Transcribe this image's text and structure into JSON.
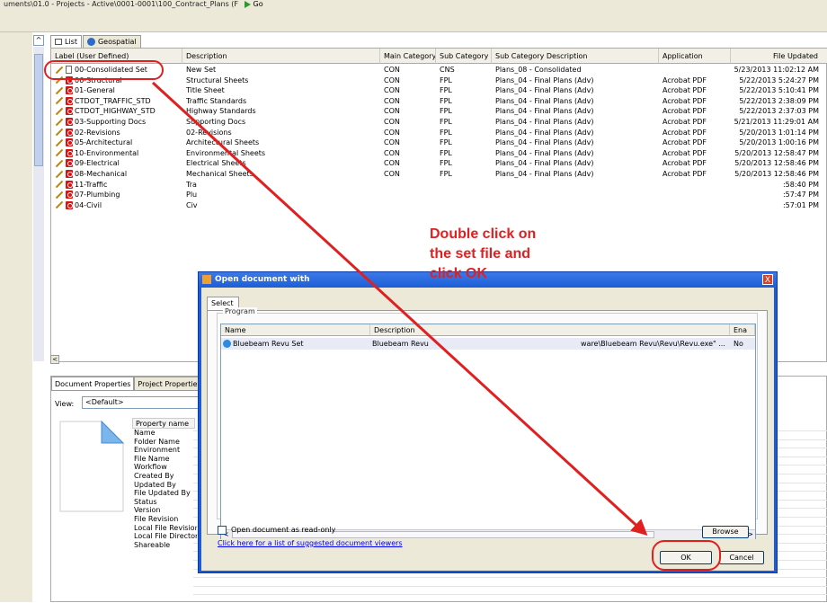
{
  "toolbar": {
    "path": "uments\\01.0 - Projects - Active\\0001-0001\\100_Contract_Plans (F",
    "go_label": "Go"
  },
  "tabs": [
    {
      "label": "List",
      "icon": "list-icon"
    },
    {
      "label": "Geospatial",
      "icon": "globe-icon"
    }
  ],
  "columns": [
    "Label (User Defined)",
    "Description",
    "Main Category",
    "Sub Category",
    "Sub Category Description",
    "Application",
    "File Updated"
  ],
  "rows": [
    {
      "label": "00-Consolidated Set",
      "desc": "New Set",
      "main": "CON",
      "sub": "CNS",
      "subdesc": "Plans_08 - Consolidated",
      "app": "",
      "updated": "5/23/2013 11:02:12 AM",
      "type": "doc"
    },
    {
      "label": "06-Structural",
      "desc": "Structural Sheets",
      "main": "CON",
      "sub": "FPL",
      "subdesc": "Plans_04 - Final Plans (Adv)",
      "app": "Acrobat PDF",
      "updated": "5/22/2013 5:24:27 PM",
      "type": "pdf"
    },
    {
      "label": "01-General",
      "desc": "Title Sheet",
      "main": "CON",
      "sub": "FPL",
      "subdesc": "Plans_04 - Final Plans (Adv)",
      "app": "Acrobat PDF",
      "updated": "5/22/2013 5:10:41 PM",
      "type": "pdf"
    },
    {
      "label": "CTDOT_TRAFFIC_STD",
      "desc": "Traffic Standards",
      "main": "CON",
      "sub": "FPL",
      "subdesc": "Plans_04 - Final Plans (Adv)",
      "app": "Acrobat PDF",
      "updated": "5/22/2013 2:38:09 PM",
      "type": "pdf"
    },
    {
      "label": "CTDOT_HIGHWAY_STD",
      "desc": "Highway Standards",
      "main": "CON",
      "sub": "FPL",
      "subdesc": "Plans_04 - Final Plans (Adv)",
      "app": "Acrobat PDF",
      "updated": "5/22/2013 2:37:03 PM",
      "type": "pdf"
    },
    {
      "label": "03-Supporting Docs",
      "desc": "Supporting Docs",
      "main": "CON",
      "sub": "FPL",
      "subdesc": "Plans_04 - Final Plans (Adv)",
      "app": "Acrobat PDF",
      "updated": "5/21/2013 11:29:01 AM",
      "type": "pdf"
    },
    {
      "label": "02-Revisions",
      "desc": "02-Revisions",
      "main": "CON",
      "sub": "FPL",
      "subdesc": "Plans_04 - Final Plans (Adv)",
      "app": "Acrobat PDF",
      "updated": "5/20/2013 1:01:14 PM",
      "type": "pdf"
    },
    {
      "label": "05-Architectural",
      "desc": "Architectural Sheets",
      "main": "CON",
      "sub": "FPL",
      "subdesc": "Plans_04 - Final Plans (Adv)",
      "app": "Acrobat PDF",
      "updated": "5/20/2013 1:00:16 PM",
      "type": "pdf"
    },
    {
      "label": "10-Environmental",
      "desc": "Environmental Sheets",
      "main": "CON",
      "sub": "FPL",
      "subdesc": "Plans_04 - Final Plans (Adv)",
      "app": "Acrobat PDF",
      "updated": "5/20/2013 12:58:47 PM",
      "type": "pdf"
    },
    {
      "label": "09-Electrical",
      "desc": "Electrical Sheets",
      "main": "CON",
      "sub": "FPL",
      "subdesc": "Plans_04 - Final Plans (Adv)",
      "app": "Acrobat PDF",
      "updated": "5/20/2013 12:58:46 PM",
      "type": "pdf"
    },
    {
      "label": "08-Mechanical",
      "desc": "Mechanical Sheets",
      "main": "CON",
      "sub": "FPL",
      "subdesc": "Plans_04 - Final Plans (Adv)",
      "app": "Acrobat PDF",
      "updated": "5/20/2013 12:58:46 PM",
      "type": "pdf"
    },
    {
      "label": "11-Traffic",
      "desc": "Tra",
      "main": "",
      "sub": "",
      "subdesc": "",
      "app": "",
      "updated": ":58:40 PM",
      "type": "pdf"
    },
    {
      "label": "07-Plumbing",
      "desc": "Plu",
      "main": "",
      "sub": "",
      "subdesc": "",
      "app": "",
      "updated": ":57:47 PM",
      "type": "pdf"
    },
    {
      "label": "04-Civil",
      "desc": "Civ",
      "main": "",
      "sub": "",
      "subdesc": "",
      "app": "",
      "updated": ":57:01 PM",
      "type": "pdf"
    }
  ],
  "bottom": {
    "tabs": [
      "Document Properties",
      "Project Properties"
    ],
    "view_label": "View:",
    "view_value": "<Default>",
    "prop_header": "Property name",
    "props": [
      "Name",
      "Folder Name",
      "Environment",
      "File Name",
      "Workflow",
      "Created By",
      "Updated By",
      "File Updated By",
      "Status",
      "Version",
      "File Revision",
      "Local File Revision",
      "Local File Directory",
      "Shareable"
    ]
  },
  "dialog": {
    "title": "Open document with",
    "tab": "Select",
    "group": "Program",
    "cols": [
      "Name",
      "Description",
      "Ena"
    ],
    "program": {
      "name": "Bluebeam Revu Set",
      "desc": "Bluebeam Revu",
      "path": "ware\\Bluebeam Revu\\Revu\\Revu.exe\" ...",
      "enabled": "No"
    },
    "browse": "Browse",
    "readonly": "Open document as read-only",
    "link": "Click here for a list of suggested document viewers",
    "ok": "OK",
    "cancel": "Cancel",
    "close": "X"
  },
  "annotation": {
    "line1": "Double click on",
    "line2": "the set file and",
    "line3": "click OK",
    "color": "#e02020"
  }
}
